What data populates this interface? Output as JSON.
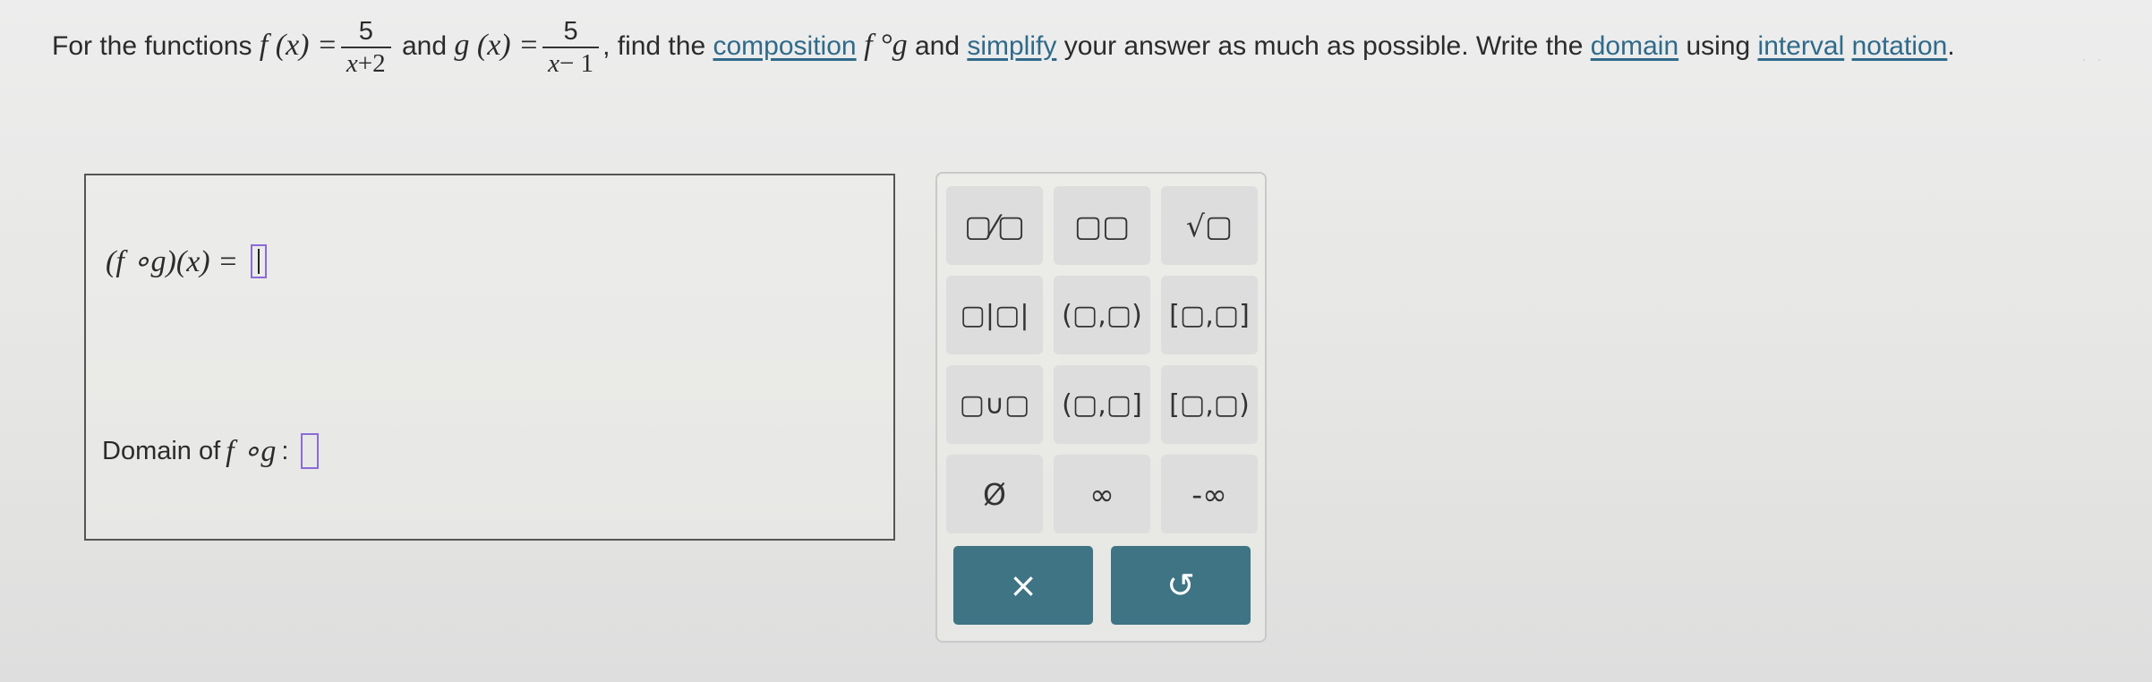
{
  "question": {
    "lead": "For the functions ",
    "f_label": "f (x) =",
    "f_num": "5",
    "f_den_var": "x",
    "f_den_rest": "+2",
    "and": " and ",
    "g_label": "g (x) =",
    "g_num": "5",
    "g_den_var": "x",
    "g_den_rest": "− 1",
    "comma_find": ", find the ",
    "composition_link": "composition",
    "fog": " f °g",
    "and_simplify": " and ",
    "simplify_link": "simplify",
    "middle": " your answer as much as possible. Write the ",
    "domain_link": "domain",
    "using": " using ",
    "interval_link": "interval",
    "space": " ",
    "notation_link": "notation",
    "period": "."
  },
  "answer": {
    "comp_label": "(f ∘g)(x) =",
    "domain_label": "Domain of",
    "domain_fog": "f ∘g",
    "domain_colon": ":"
  },
  "palette": {
    "keys": {
      "fraction": "▢⁄▢",
      "exponent": "▢▢",
      "sqrt": "√▢",
      "abs": "▢|▢|",
      "open_open": "(▢,▢)",
      "closed_closed": "[▢,▢]",
      "union": "▢∪▢",
      "open_closed": "(▢,▢]",
      "closed_open": "[▢,▢)",
      "empty_set": "Ø",
      "infinity": "∞",
      "neg_infinity": "-∞"
    },
    "clear_label": "×",
    "undo_label": "↺"
  },
  "colors": {
    "link": "#2f6a8a",
    "action_button": "#3e7484",
    "active_slot": "#8a6ad8"
  }
}
